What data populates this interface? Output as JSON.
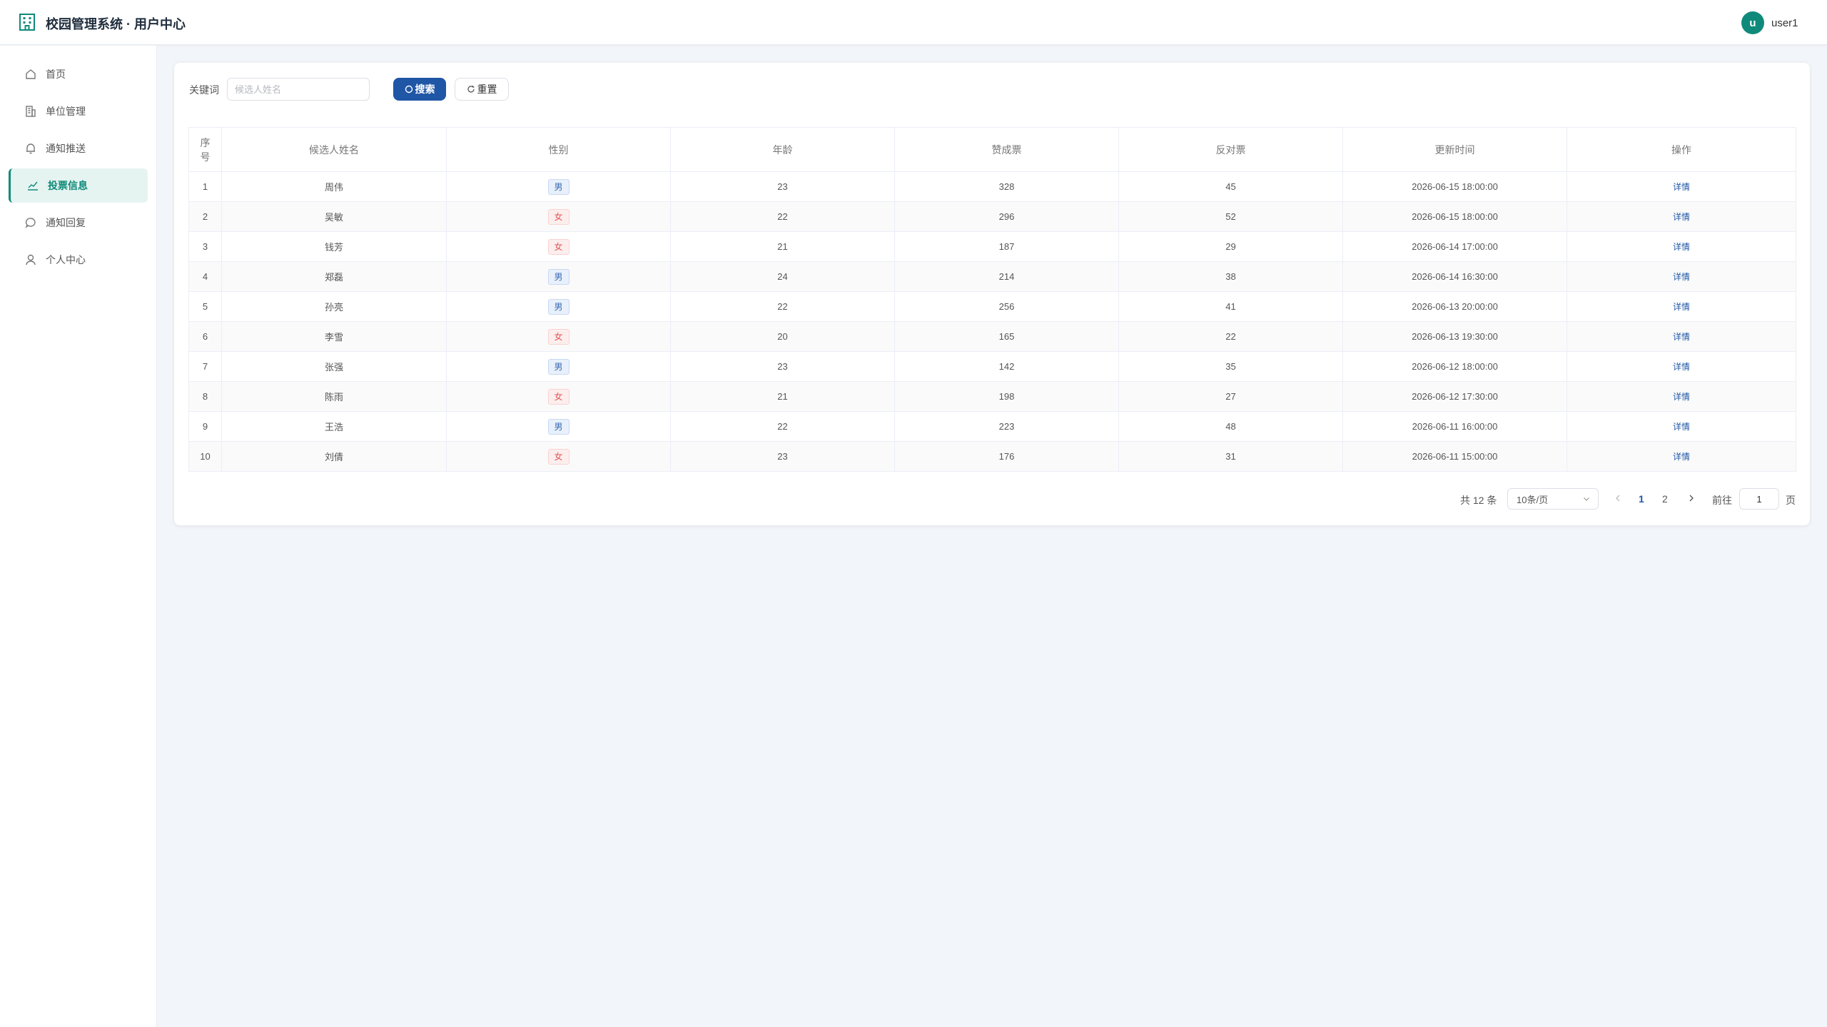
{
  "header": {
    "app_title": "校园管理系统 · 用户中心",
    "avatar_letter": "u",
    "username": "user1"
  },
  "sidebar": {
    "items": [
      {
        "label": "首页",
        "icon": "home-icon"
      },
      {
        "label": "单位管理",
        "icon": "building-icon"
      },
      {
        "label": "通知推送",
        "icon": "bell-icon"
      },
      {
        "label": "投票信息",
        "icon": "vote-chart-icon",
        "active": true
      },
      {
        "label": "通知回复",
        "icon": "chat-icon"
      },
      {
        "label": "个人中心",
        "icon": "user-icon"
      }
    ]
  },
  "search": {
    "keyword_label": "关键词",
    "placeholder": "候选人姓名",
    "value": "",
    "search_label": "搜索",
    "reset_label": "重置"
  },
  "table": {
    "columns": [
      "序号",
      "候选人姓名",
      "性别",
      "年龄",
      "赞成票",
      "反对票",
      "更新时间",
      "操作"
    ],
    "rows": [
      {
        "no": "1",
        "name": "周伟",
        "gender": "男",
        "age": "23",
        "yes": "328",
        "no_votes": "45",
        "updated": "2026-06-15 18:00:00",
        "action": "详情"
      },
      {
        "no": "2",
        "name": "吴敏",
        "gender": "女",
        "age": "22",
        "yes": "296",
        "no_votes": "52",
        "updated": "2026-06-15 18:00:00",
        "action": "详情"
      },
      {
        "no": "3",
        "name": "钱芳",
        "gender": "女",
        "age": "21",
        "yes": "187",
        "no_votes": "29",
        "updated": "2026-06-14 17:00:00",
        "action": "详情"
      },
      {
        "no": "4",
        "name": "郑磊",
        "gender": "男",
        "age": "24",
        "yes": "214",
        "no_votes": "38",
        "updated": "2026-06-14 16:30:00",
        "action": "详情"
      },
      {
        "no": "5",
        "name": "孙亮",
        "gender": "男",
        "age": "22",
        "yes": "256",
        "no_votes": "41",
        "updated": "2026-06-13 20:00:00",
        "action": "详情"
      },
      {
        "no": "6",
        "name": "李雪",
        "gender": "女",
        "age": "20",
        "yes": "165",
        "no_votes": "22",
        "updated": "2026-06-13 19:30:00",
        "action": "详情"
      },
      {
        "no": "7",
        "name": "张强",
        "gender": "男",
        "age": "23",
        "yes": "142",
        "no_votes": "35",
        "updated": "2026-06-12 18:00:00",
        "action": "详情"
      },
      {
        "no": "8",
        "name": "陈雨",
        "gender": "女",
        "age": "21",
        "yes": "198",
        "no_votes": "27",
        "updated": "2026-06-12 17:30:00",
        "action": "详情"
      },
      {
        "no": "9",
        "name": "王浩",
        "gender": "男",
        "age": "22",
        "yes": "223",
        "no_votes": "48",
        "updated": "2026-06-11 16:00:00",
        "action": "详情"
      },
      {
        "no": "10",
        "name": "刘倩",
        "gender": "女",
        "age": "23",
        "yes": "176",
        "no_votes": "31",
        "updated": "2026-06-11 15:00:00",
        "action": "详情"
      }
    ]
  },
  "pagination": {
    "total_text": "共 12 条",
    "page_size": "10条/页",
    "pages": [
      "1",
      "2"
    ],
    "current_page": "1",
    "goto_label": "前往",
    "goto_value": "1",
    "page_suffix": "页"
  },
  "colors": {
    "accent": "#0f8a7a",
    "primary_button": "#1f56a6",
    "male_tag": "#3a69b3",
    "female_tag": "#e25555",
    "background": "#f2f5fa"
  }
}
